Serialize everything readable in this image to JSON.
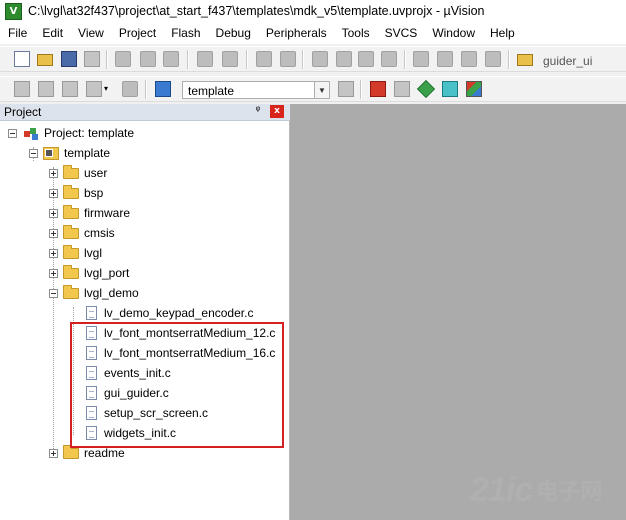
{
  "window": {
    "title": "C:\\lvgl\\at32f437\\project\\at_start_f437\\templates\\mdk_v5\\template.uvprojx - µVision",
    "app_icon_letter": "V"
  },
  "menu": [
    "File",
    "Edit",
    "View",
    "Project",
    "Flash",
    "Debug",
    "Peripherals",
    "Tools",
    "SVCS",
    "Window",
    "Help"
  ],
  "toolbar": {
    "find_text": "guider_ui",
    "target_name": "template"
  },
  "project_panel": {
    "title": "Project",
    "pin_glyph": "ᵠ",
    "close_glyph": "x"
  },
  "tree": {
    "project_label": "Project: template",
    "target_label": "template",
    "groups": {
      "user": "user",
      "bsp": "bsp",
      "firmware": "firmware",
      "cmsis": "cmsis",
      "lvgl": "lvgl",
      "lvgl_port": "lvgl_port",
      "lvgl_demo": "lvgl_demo",
      "readme": "readme"
    },
    "lvgl_demo_files": [
      "lv_demo_keypad_encoder.c",
      "lv_font_montserratMedium_12.c",
      "lv_font_montserratMedium_16.c",
      "events_init.c",
      "gui_guider.c",
      "setup_scr_screen.c",
      "widgets_init.c"
    ]
  },
  "watermark": {
    "number": "21ic",
    "chinese": "电子网"
  },
  "colors": {
    "highlight_border": "#d42020",
    "editor_background": "#ababab",
    "panel_header": "#dde3ec"
  }
}
